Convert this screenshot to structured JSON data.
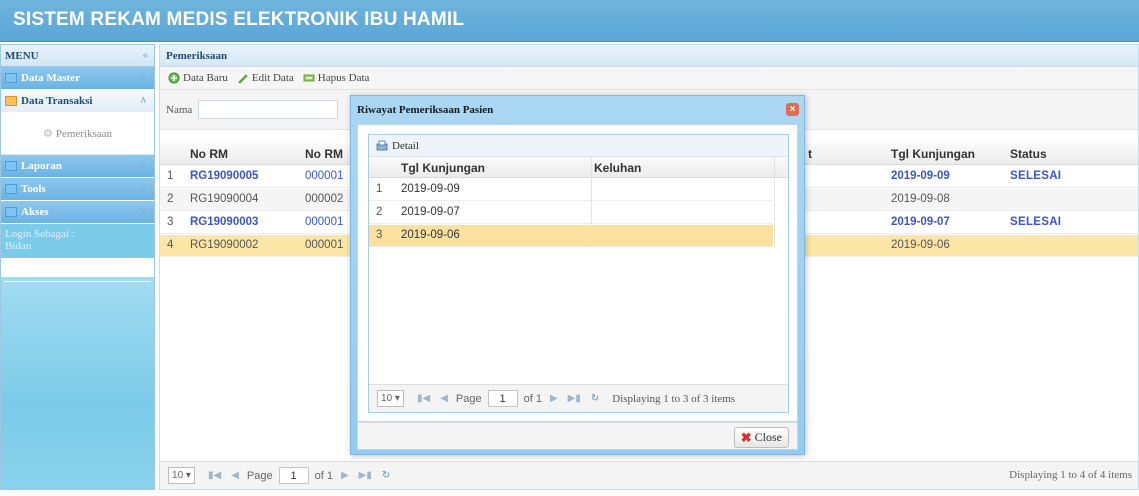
{
  "app": {
    "title": "SISTEM REKAM MEDIS ELEKTRONIK IBU HAMIL"
  },
  "menu": {
    "title": "MENU",
    "collapse_icon": "double-chevron-left-icon",
    "items": [
      {
        "label": "Data Master"
      },
      {
        "label": "Data Transaksi"
      },
      {
        "label": "Laporan"
      },
      {
        "label": "Tools"
      },
      {
        "label": "Akses"
      }
    ],
    "sub_item": "Pemeriksaan",
    "login_label": "Login Sebagai :",
    "login_role": "Bidan"
  },
  "main": {
    "panel_title": "Pemeriksaan",
    "toolbar": {
      "new_label": "Data Baru",
      "edit_label": "Edit Data",
      "delete_label": "Hapus Data"
    },
    "search_label": "Nama",
    "columns": [
      "No RM",
      "No RM",
      "t",
      "Tgl Kunjungan",
      "Status"
    ],
    "rows": [
      {
        "n": "1",
        "rm": "RG19090005",
        "rm2": "000001",
        "tgl": "2019-09-09",
        "status": "SELESAI"
      },
      {
        "n": "2",
        "rm": "RG19090004",
        "rm2": "000002",
        "tgl": "2019-09-08",
        "status": ""
      },
      {
        "n": "3",
        "rm": "RG19090003",
        "rm2": "000001",
        "tgl": "2019-09-07",
        "status": "SELESAI"
      },
      {
        "n": "4",
        "rm": "RG19090002",
        "rm2": "000001",
        "tgl": "2019-09-06",
        "status": ""
      }
    ],
    "pager": {
      "page_size": "10",
      "page_label": "Page",
      "page": "1",
      "of_label": "of 1",
      "display": "Displaying 1 to 4 of 4 items"
    }
  },
  "modal": {
    "title": "Riwayat Pemeriksaan Pasien",
    "toolbar_detail": "Detail",
    "columns": [
      "Tgl Kunjungan",
      "Keluhan"
    ],
    "rows": [
      {
        "n": "1",
        "tgl": "2019-09-09",
        "keluhan": ""
      },
      {
        "n": "2",
        "tgl": "2019-09-07",
        "keluhan": ""
      },
      {
        "n": "3",
        "tgl": "2019-09-06",
        "keluhan": ""
      }
    ],
    "pager": {
      "page_size": "10",
      "page_label": "Page",
      "page": "1",
      "of_label": "of 1",
      "display": "Displaying 1 to 3 of 3 items"
    },
    "close_label": "Close"
  },
  "colors": {
    "header": "#5aa6d6",
    "link": "#3d56c4",
    "selected_row": "#fbe6a5",
    "menu_bg": "#7ccbe9"
  }
}
